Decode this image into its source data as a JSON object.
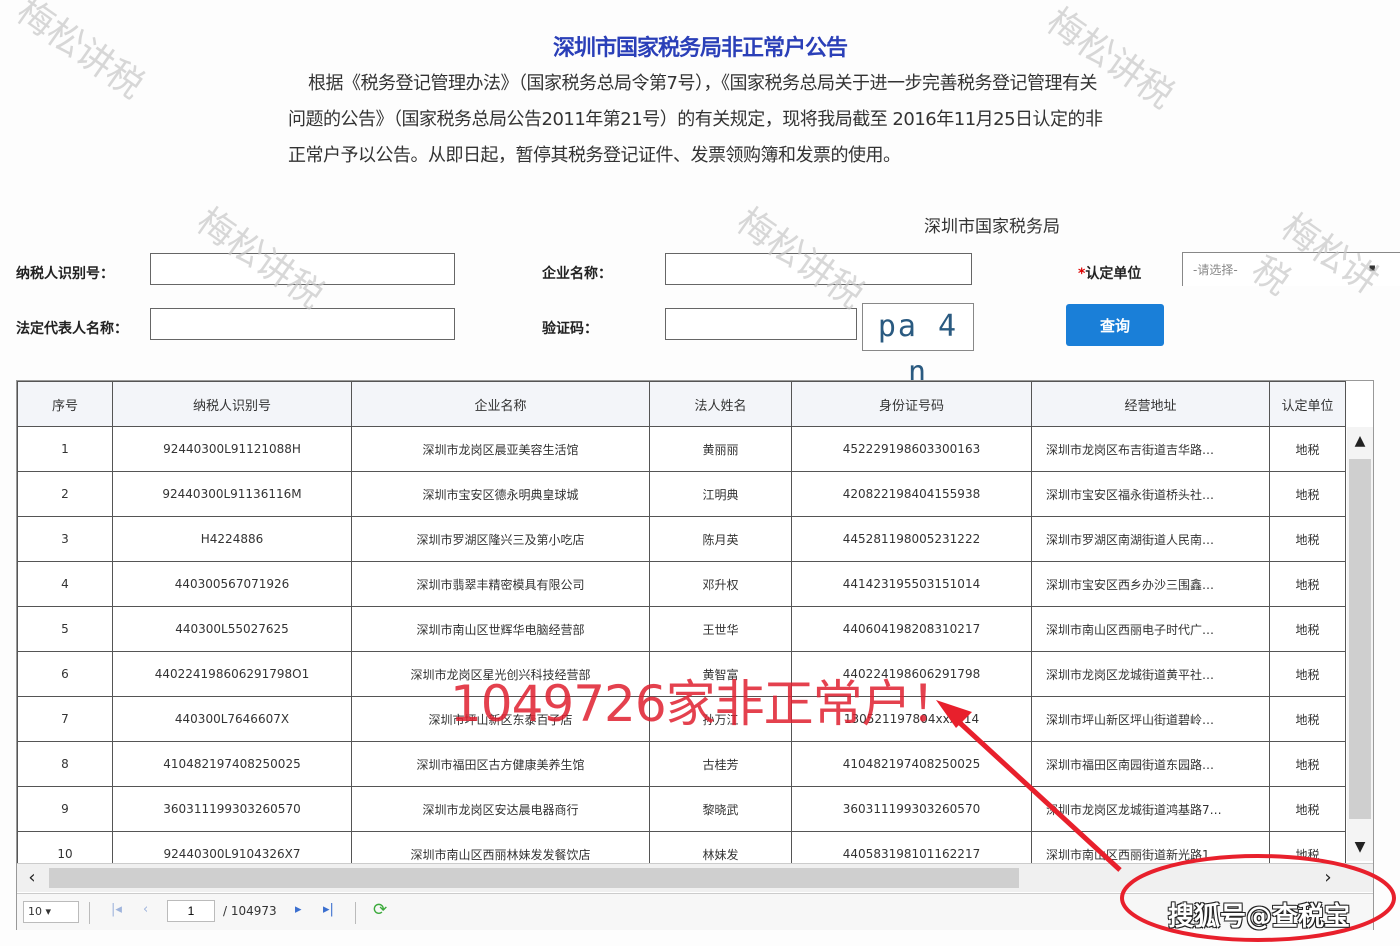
{
  "page": {
    "title": "深圳市国家税务局非正常户公告",
    "notice": "根据《税务登记管理办法》（国家税务总局令第7号），《国家税务总局关于进一步完善税务登记管理有关问题的公告》（国家税务总局公告2011年第21号）的有关规定，现将我局截至 2016年11月25日认定的非正常户予以公告。从即日起，暂停其税务登记证件、发票领购簿和发票的使用。",
    "signer": "深圳市国家税务局"
  },
  "form": {
    "taxpayer_id_label": "纳税人识别号：",
    "taxpayer_id_value": "",
    "company_name_label": "企业名称：",
    "company_name_value": "",
    "legal_rep_label": "法定代表人名称：",
    "legal_rep_value": "",
    "captcha_label": "验证码：",
    "captcha_value": "",
    "captcha_image_text": "pa 4 n",
    "unit_required_mark": "*",
    "unit_label": "认定单位",
    "unit_selected": "-请选择-",
    "search_button": "查询"
  },
  "table": {
    "columns": [
      "序号",
      "纳税人识别号",
      "企业名称",
      "法人姓名",
      "身份证号码",
      "经营地址",
      "认定单位"
    ],
    "rows": [
      [
        "1",
        "92440300L91121088H",
        "深圳市龙岗区晨亚美容生活馆",
        "黄丽丽",
        "452229198603300163",
        "深圳市龙岗区布吉街道吉华路…",
        "地税"
      ],
      [
        "2",
        "92440300L91136116M",
        "深圳市宝安区德永明典皇球城",
        "江明典",
        "420822198404155938",
        "深圳市宝安区福永街道桥头社…",
        "地税"
      ],
      [
        "3",
        "H4224886",
        "深圳市罗湖区隆兴三及第小吃店",
        "陈月英",
        "445281198005231222",
        "深圳市罗湖区南湖街道人民南…",
        "地税"
      ],
      [
        "4",
        "440300567071926",
        "深圳市翡翠丰精密模具有限公司",
        "邓升权",
        "441423195503151014",
        "深圳市宝安区西乡办沙三围鑫…",
        "地税"
      ],
      [
        "5",
        "440300L55027625",
        "深圳市南山区世辉华电脑经营部",
        "王世华",
        "440604198208310217",
        "深圳市南山区西丽电子时代广…",
        "地税"
      ],
      [
        "6",
        "440224198606291798O1",
        "深圳市龙岗区星光创兴科技经营部",
        "黄智富",
        "440224198606291798",
        "深圳市龙岗区龙城街道黄平社…",
        "地税"
      ],
      [
        "7",
        "440300L7646607X",
        "深圳市坪山新区东泰百子店",
        "孙万江",
        "130521197804xxxx14",
        "深圳市坪山新区坪山街道碧岭…",
        "地税"
      ],
      [
        "8",
        "410482197408250025",
        "深圳市福田区古方健康美养生馆",
        "古桂芳",
        "410482197408250025",
        "深圳市福田区南园街道东园路…",
        "地税"
      ],
      [
        "9",
        "360311199303260570",
        "深圳市龙岗区安达晨电器商行",
        "黎晓武",
        "360311199303260570",
        "深圳市龙岗区龙城街道鸿基路7…",
        "地税"
      ],
      [
        "10",
        "92440300L9104326X7",
        "深圳市南山区西丽林妹发发餐饮店",
        "林妹发",
        "440583198101162217",
        "深圳市南山区西丽街道新光路1…",
        "地税"
      ]
    ]
  },
  "pager": {
    "page_size": "10 ▾",
    "current_page": "1",
    "total_pages": "/ 104973"
  },
  "annotation": {
    "headline": "1049726家非正常户！",
    "color": "#e02030"
  },
  "watermarks": [
    "梅松讲税",
    "梅松讲税",
    "梅松讲税",
    "梅松讲税",
    "梅松讲税"
  ],
  "credit": "搜狐号@查税宝"
}
